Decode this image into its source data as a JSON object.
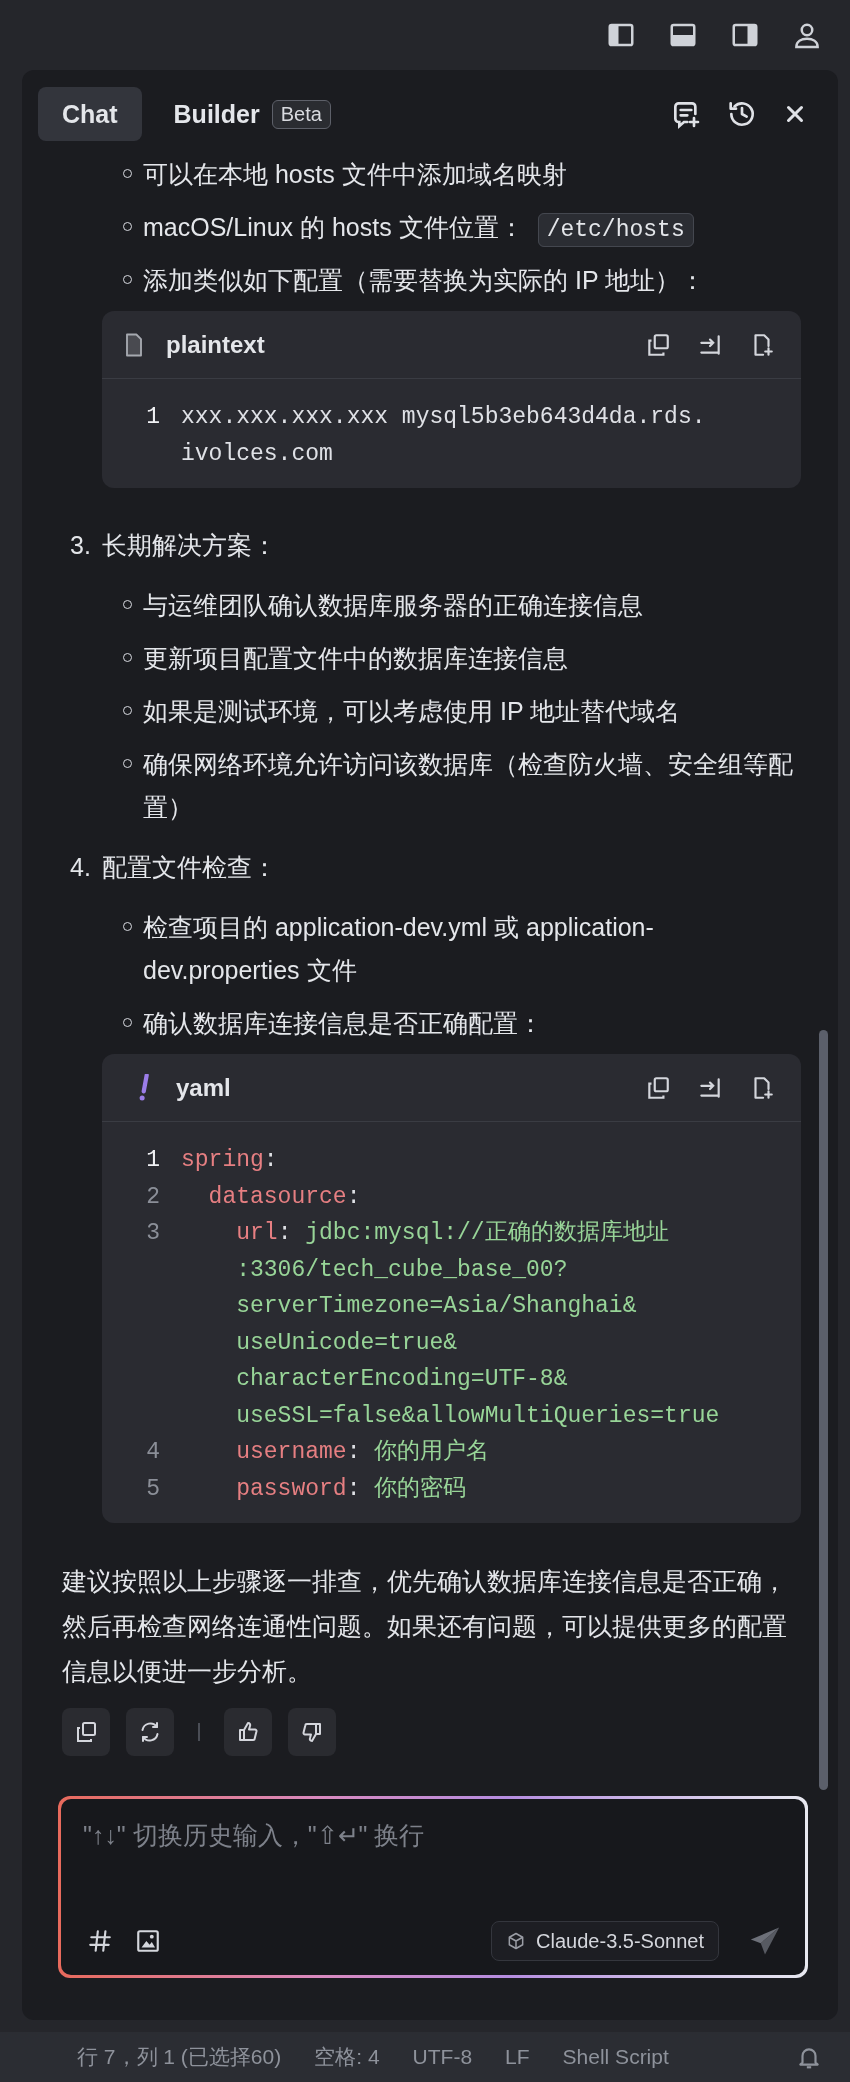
{
  "tabs": [
    {
      "label": "Chat",
      "selected": true
    },
    {
      "label": "Builder",
      "badge": "Beta",
      "selected": false
    }
  ],
  "content": [
    {
      "kind": "bullets",
      "items": [
        {
          "text": "可以在本地 hosts 文件中添加域名映射"
        },
        {
          "text": "macOS/Linux 的 hosts 文件位置：",
          "code": "/etc/hosts"
        },
        {
          "text": "添加类似如下配置（需要替换为实际的 IP 地址）："
        }
      ]
    },
    {
      "kind": "code",
      "syntax_highlight": false,
      "language": "plaintext",
      "lines": [
        {
          "number": "1",
          "current": true,
          "value": [
            "xxx.xxx.xxx.xxx mysql5b3eb643d4da.rds.",
            "ivolces.com"
          ]
        }
      ]
    },
    {
      "kind": "numbered",
      "number": "3.",
      "text": "长期解决方案："
    },
    {
      "kind": "bullets",
      "items": [
        {
          "text": "与运维团队确认数据库服务器的正确连接信息"
        },
        {
          "text": "更新项目配置文件中的数据库连接信息"
        },
        {
          "text": "如果是测试环境，可以考虑使用 IP 地址替代域名"
        },
        {
          "text": "确保网络环境允许访问该数据库（检查防火墙、安全组等配置）"
        }
      ]
    },
    {
      "kind": "numbered",
      "number": "4.",
      "text": "配置文件检查："
    },
    {
      "kind": "bullets",
      "items": [
        {
          "text": "检查项目的 application-dev.yml 或 application-dev.properties 文件"
        },
        {
          "text": "确认数据库连接信息是否正确配置："
        }
      ]
    },
    {
      "kind": "code",
      "syntax_highlight": true,
      "language": "yaml",
      "lines": [
        {
          "number": "1",
          "current": true,
          "key": "spring",
          "sep": ":"
        },
        {
          "number": "2",
          "current": false,
          "key": "  datasource",
          "sep": ":"
        },
        {
          "number": "3",
          "current": false,
          "key": "    url",
          "sep": ": ",
          "value": [
            "jdbc:mysql://正确的数据库地址",
            ":3306/tech_cube_base_00?",
            "serverTimezone=Asia/Shanghai&",
            "useUnicode=true&",
            "characterEncoding=UTF-8&",
            "useSSL=false&allowMultiQueries=true"
          ]
        },
        {
          "number": "4",
          "current": false,
          "key": "    username",
          "sep": ": ",
          "value": [
            "你的用户名"
          ]
        },
        {
          "number": "5",
          "current": false,
          "key": "    password",
          "sep": ": ",
          "value": [
            "你的密码"
          ]
        }
      ]
    },
    {
      "kind": "paragraph",
      "text": "建议按照以上步骤逐一排查，优先确认数据库连接信息是否正确，然后再检查网络连通性问题。如果还有问题，可以提供更多的配置信息以便进一步分析。"
    }
  ],
  "input": {
    "placeholder": "\"↑↓\" 切换历史输入，\"⇧↵\" 换行",
    "model": "Claude-3.5-Sonnet"
  },
  "status_bar": [
    "行 7，列 1 (已选择60)",
    "空格: 4",
    "UTF-8",
    "LF",
    "Shell Script"
  ]
}
